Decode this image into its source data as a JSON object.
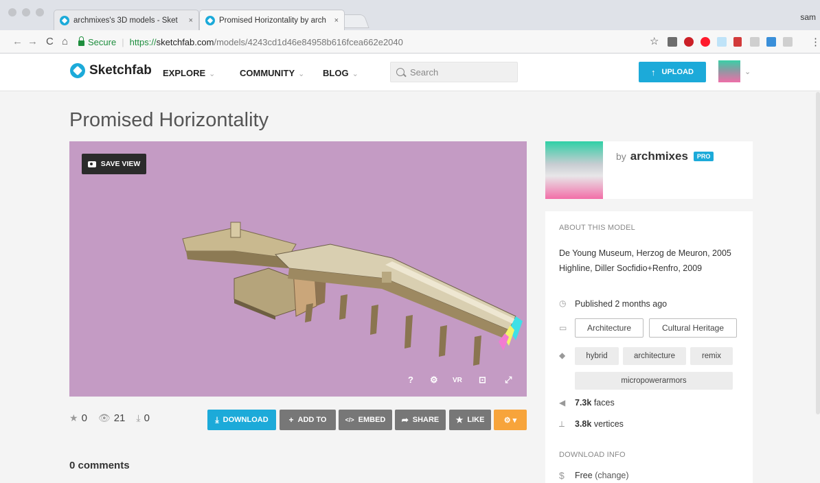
{
  "browser": {
    "tabs": [
      {
        "title": "archmixes's 3D models - Sket",
        "close": "×"
      },
      {
        "title": "Promised Horizontality by arch",
        "close": "×"
      }
    ],
    "profile": "sam",
    "nav": {
      "back": "←",
      "forward": "→",
      "reload": "C",
      "home": "⌂"
    },
    "secure_label": "Secure",
    "url_proto": "https://",
    "url_host": "sketchfab.com",
    "url_path": "/models/4243cd1d46e84958b616fcea662e2040",
    "star": "☆",
    "menu": "⋮"
  },
  "header": {
    "logo_text": "Sketchfab",
    "nav": [
      {
        "label": "EXPLORE",
        "chev": "⌄"
      },
      {
        "label": "COMMUNITY",
        "chev": "⌄"
      },
      {
        "label": "BLOG",
        "chev": "⌄"
      }
    ],
    "search_placeholder": "Search",
    "upload_label": "UPLOAD",
    "upload_icon": "↑",
    "avatar_chev": "⌄"
  },
  "model": {
    "title": "Promised Horizontality",
    "save_view_label": "SAVE VIEW",
    "viewer_controls": [
      "?",
      "⚙",
      "VR",
      "⊡",
      "⤢"
    ],
    "stats": {
      "likes": "0",
      "views": "21",
      "downloads": "0"
    },
    "stat_icons": {
      "likes": "★",
      "views": "👁",
      "downloads": "⤓"
    },
    "actions": [
      {
        "label": "DOWNLOAD",
        "icon": "⤓"
      },
      {
        "label": "ADD TO",
        "icon": "+"
      },
      {
        "label": "EMBED",
        "icon": "</>"
      },
      {
        "label": "SHARE",
        "icon": "➦"
      },
      {
        "label": "LIKE",
        "icon": "★"
      }
    ],
    "more_icon": "⚙ ▾",
    "comments": "0 comments"
  },
  "author": {
    "by": "by",
    "name": "archmixes",
    "badge": "PRO"
  },
  "about": {
    "section_title": "ABOUT THIS MODEL",
    "description_lines": [
      "De Young Museum, Herzog de Meuron, 2005",
      "Highline, Diller Socfidio+Renfro, 2009"
    ],
    "published": "Published 2 months ago",
    "categories": [
      "Architecture",
      "Cultural Heritage"
    ],
    "tags": [
      "hybrid",
      "architecture",
      "remix",
      "micropowerarmors"
    ],
    "faces_value": "7.3k",
    "faces_label": "faces",
    "vertices_value": "3.8k",
    "vertices_label": "vertices",
    "download_info_title": "DOWNLOAD INFO",
    "price_icon": "$",
    "price": "Free",
    "price_change": "(change)",
    "icons": {
      "published": "◷",
      "categories": "▭",
      "tags": "◆",
      "faces": "◀",
      "vertices": "⟂"
    }
  },
  "colors": {
    "accent": "#1caad9",
    "viewer_bg": "#c49bc4",
    "action_grey": "#777777",
    "more_orange": "#f7a43b"
  }
}
